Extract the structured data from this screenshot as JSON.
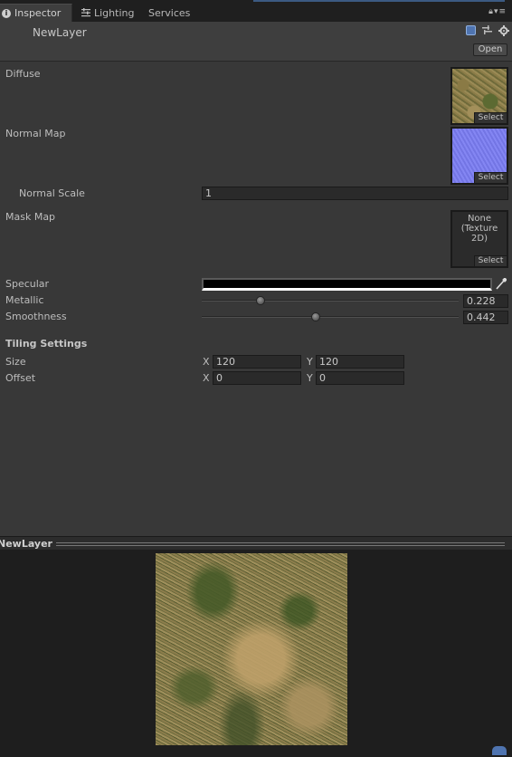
{
  "tabs": [
    {
      "label": "Inspector",
      "active": true,
      "icon": "info-icon"
    },
    {
      "label": "Lighting",
      "active": false,
      "icon": "lighting-icon"
    },
    {
      "label": "Services",
      "active": false
    }
  ],
  "header": {
    "asset_name": "NewLayer",
    "open_label": "Open",
    "icons": [
      "help-book-icon",
      "preset-icon",
      "gear-icon"
    ]
  },
  "properties": {
    "diffuse": {
      "label": "Diffuse",
      "select_label": "Select",
      "texture": "grass"
    },
    "normal_map": {
      "label": "Normal Map",
      "select_label": "Select",
      "texture": "normal"
    },
    "normal_scale": {
      "label": "Normal Scale",
      "value": "1"
    },
    "mask_map": {
      "label": "Mask Map",
      "none_text": "None\n(Texture\n2D)",
      "select_label": "Select"
    },
    "specular": {
      "label": "Specular",
      "color": "#000000"
    },
    "metallic": {
      "label": "Metallic",
      "value": "0.228",
      "fraction": 0.228
    },
    "smoothness": {
      "label": "Smoothness",
      "value": "0.442",
      "fraction": 0.442
    }
  },
  "tiling": {
    "section_label": "Tiling Settings",
    "size": {
      "label": "Size",
      "x_label": "X",
      "x": "120",
      "y_label": "Y",
      "y": "120"
    },
    "offset": {
      "label": "Offset",
      "x_label": "X",
      "x": "0",
      "y_label": "Y",
      "y": "0"
    }
  },
  "preview": {
    "title": "NewLayer"
  }
}
